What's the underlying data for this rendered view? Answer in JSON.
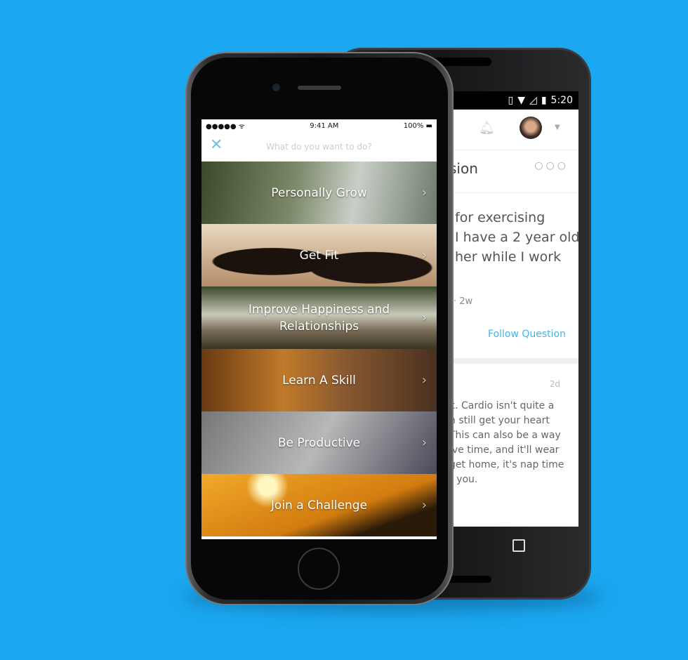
{
  "background_color": "#1ba8f0",
  "android": {
    "status": {
      "icons": [
        "vibrate-icon",
        "wifi-icon",
        "signal-icon",
        "battery-charging-icon"
      ],
      "time": "5:20"
    },
    "header": {
      "icons": [
        "bell-icon",
        "avatar",
        "caret-down-icon"
      ]
    },
    "question_title_fragment": "sion",
    "question_lines": [
      "for exercising",
      "I have a 2 year old",
      "her while I work"
    ],
    "meta": "· 2w",
    "follow_label": "Follow Question",
    "answer_age": "2d",
    "answer_lines": [
      "k. Cardio isn't quite a",
      "n still get your heart",
      "This can also be a way",
      "ive time, and it'll wear",
      "get home, it's nap time",
      "r you."
    ],
    "accent": "#45b4e8"
  },
  "iphone": {
    "status": {
      "signal": "●●●●● ᯤ",
      "time": "9:41 AM",
      "battery": "100%"
    },
    "search_placeholder": "What do you want to do?",
    "accent": "#6fc2ea",
    "items": [
      {
        "label": "Personally Grow"
      },
      {
        "label": "Get Fit"
      },
      {
        "label": "Improve Happiness and Relationships"
      },
      {
        "label": "Learn A Skill"
      },
      {
        "label": "Be Productive"
      },
      {
        "label": "Join a Challenge"
      }
    ]
  }
}
